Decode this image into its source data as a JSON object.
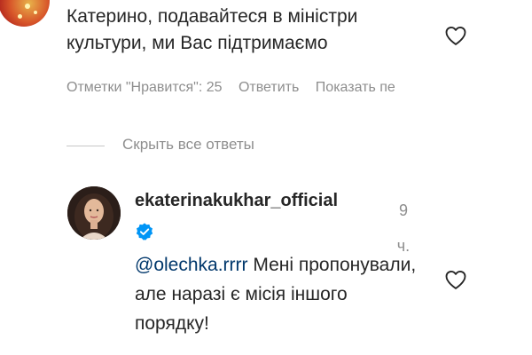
{
  "comment1": {
    "text": "Катерино, подавайтеся в міністри культури, ми Вас підтримаємо",
    "likes_label": "Отметки \"Нравится\": 25",
    "reply_label": "Ответить",
    "show_label": "Показать пе"
  },
  "replies": {
    "hide_label": "Скрыть все ответы"
  },
  "reply1": {
    "username": "ekaterinakukhar_official",
    "time_number": "9",
    "time_unit": "ч.",
    "mention": "@olechka.rrrr",
    "text": " Мені пропонували, але наразі є місія іншого порядку!"
  },
  "icons": {
    "like": "heart-outline-icon",
    "verified": "verified-badge-icon"
  },
  "colors": {
    "secondary_text": "#8e8e8e",
    "mention": "#00376b",
    "verified_blue": "#0095f6"
  }
}
